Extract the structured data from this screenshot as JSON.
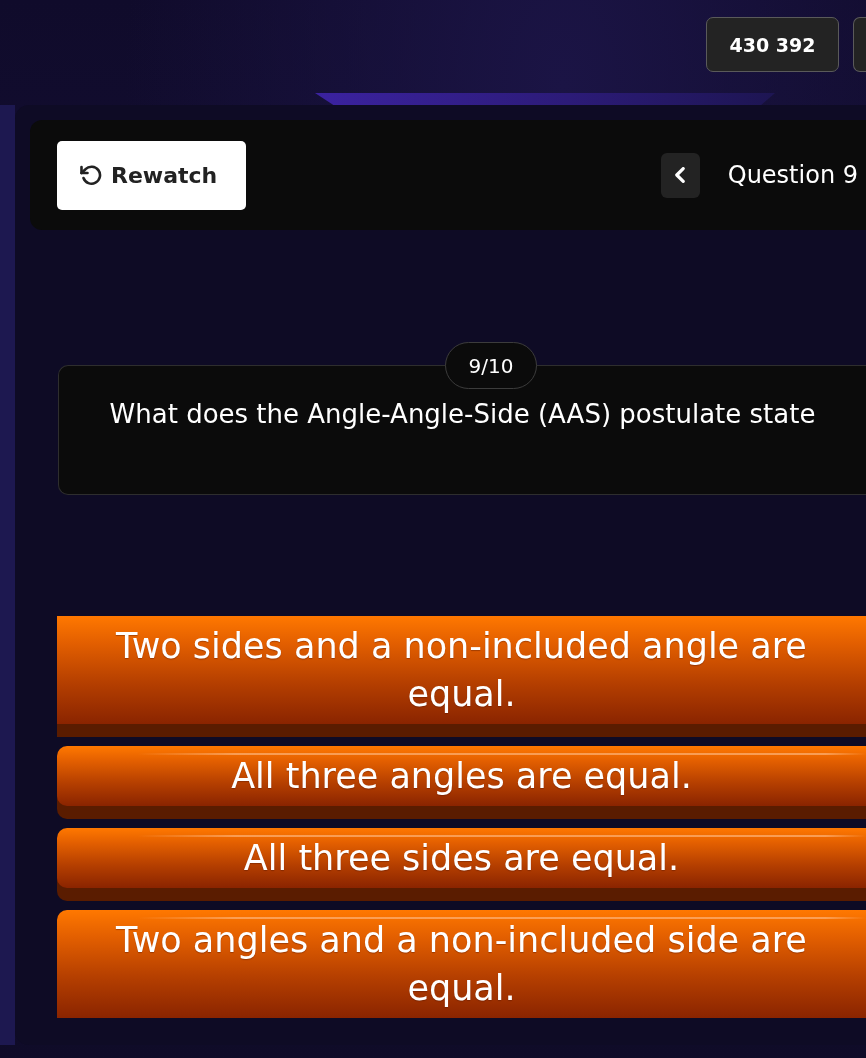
{
  "header": {
    "score": "430 392"
  },
  "toolbar": {
    "rewatch_label": "Rewatch",
    "question_label": "Question 9"
  },
  "question": {
    "counter": "9/10",
    "text": "What does the Angle-Angle-Side (AAS) postulate state"
  },
  "answers": [
    {
      "text": "Two sides and a non-included angle are equal."
    },
    {
      "text": "All three angles are equal."
    },
    {
      "text": "All three sides are equal."
    },
    {
      "text": "Two angles and a non-included side are equal."
    }
  ]
}
